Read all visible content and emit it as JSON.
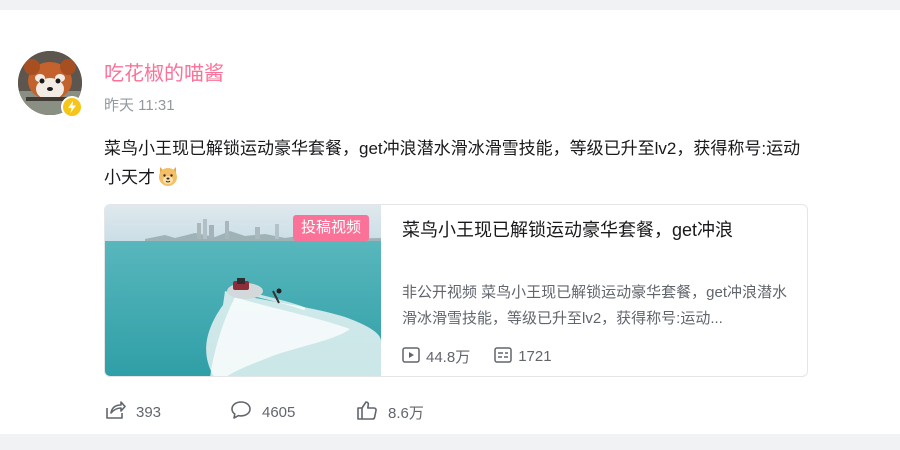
{
  "post": {
    "username": "吃花椒的喵酱",
    "timestamp": "昨天 11:31",
    "text": "菜鸟小王现已解锁运动豪华套餐，get冲浪潜水滑冰滑雪技能，等级已升至lv2，获得称号:运动小天才",
    "emoji_icon": "dog-face-emoji-icon"
  },
  "video": {
    "tag": "投稿视频",
    "title": "菜鸟小王现已解锁运动豪华套餐，get冲浪",
    "description": "非公开视频 菜鸟小王现已解锁运动豪华套餐，get冲浪潜水滑冰滑雪技能，等级已升至lv2，获得称号:运动...",
    "views": "44.8万",
    "danmaku": "1721"
  },
  "actions": {
    "share": "393",
    "comment": "4605",
    "like": "8.6万"
  },
  "colors": {
    "brand_pink": "#fb7299",
    "text_primary": "#18191c",
    "text_secondary": "#61666d",
    "text_muted": "#9499a0",
    "badge_yellow": "#f5c518"
  }
}
